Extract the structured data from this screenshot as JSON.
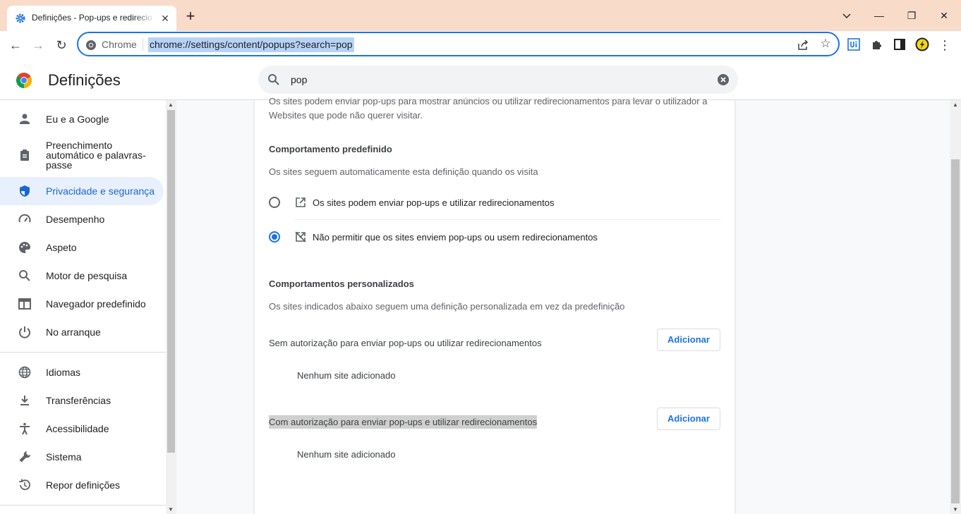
{
  "window": {
    "tab_title": "Definições - Pop-ups e redirecio",
    "tab_close": "✕",
    "new_tab": "+",
    "minimize": "—",
    "maximize": "❐",
    "close": "✕"
  },
  "toolbar": {
    "back": "←",
    "forward": "→",
    "reload": "↻",
    "site_label": "Chrome",
    "url": "chrome://settings/content/popups?search=pop",
    "bookmark": "☆",
    "menu": "⋮"
  },
  "header": {
    "title": "Definições",
    "search_value": "pop"
  },
  "sidebar": {
    "items": [
      {
        "label": "Eu e a Google",
        "icon": "person-icon"
      },
      {
        "label": "Preenchimento automático e palavras-passe",
        "icon": "clipboard-icon"
      },
      {
        "label": "Privacidade e segurança",
        "icon": "shield-icon",
        "active": true
      },
      {
        "label": "Desempenho",
        "icon": "speedometer-icon"
      },
      {
        "label": "Aspeto",
        "icon": "palette-icon"
      },
      {
        "label": "Motor de pesquisa",
        "icon": "search-icon"
      },
      {
        "label": "Navegador predefinido",
        "icon": "browser-icon"
      },
      {
        "label": "No arranque",
        "icon": "power-icon"
      },
      {
        "label": "Idiomas",
        "icon": "globe-icon"
      },
      {
        "label": "Transferências",
        "icon": "download-icon"
      },
      {
        "label": "Acessibilidade",
        "icon": "accessibility-icon"
      },
      {
        "label": "Sistema",
        "icon": "wrench-icon"
      },
      {
        "label": "Repor definições",
        "icon": "history-icon"
      }
    ]
  },
  "main": {
    "description_line1": "Os sites podem enviar pop-ups para mostrar anúncios ou utilizar redirecionamentos para levar o utilizador a",
    "description_line2": "Websites que pode não querer visitar.",
    "default_behavior": {
      "title": "Comportamento predefinido",
      "subtitle": "Os sites seguem automaticamente esta definição quando os visita",
      "options": [
        {
          "label": "Os sites podem enviar pop-ups e utilizar redirecionamentos",
          "checked": false
        },
        {
          "label": "Não permitir que os sites enviem pop-ups ou usem redirecionamentos",
          "checked": true
        }
      ]
    },
    "custom_behavior": {
      "title": "Comportamentos personalizados",
      "subtitle": "Os sites indicados abaixo seguem uma definição personalizada em vez da predefinição",
      "blocked_label": "Sem autorização para enviar pop-ups ou utilizar redirecionamentos",
      "blocked_add": "Adicionar",
      "blocked_empty": "Nenhum site adicionado",
      "allowed_label": "Com autorização para enviar pop-ups e utilizar redirecionamentos",
      "allowed_add": "Adicionar",
      "allowed_empty": "Nenhum site adicionado"
    }
  },
  "colors": {
    "accent": "#1a73e8",
    "titlebar": "#f9dbc9",
    "active_nav_bg": "#e8f0fe"
  }
}
